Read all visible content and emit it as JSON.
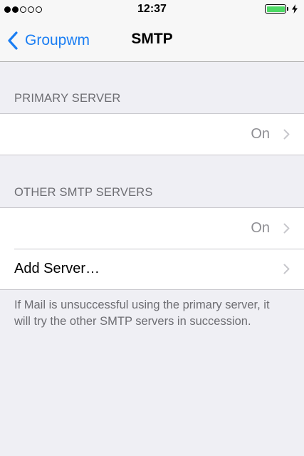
{
  "status_bar": {
    "time": "12:37",
    "signal_filled": 2,
    "signal_total": 5,
    "battery_level": 1.0,
    "battery_color": "#4cd964",
    "charging_icon": "bolt-icon"
  },
  "nav": {
    "back_label": "Groupwm",
    "back_icon": "chevron-left-icon",
    "title": "SMTP",
    "accent_color": "#1a7ef3"
  },
  "primary_section": {
    "header": "PRIMARY SERVER",
    "rows": [
      {
        "label": "",
        "value": "On",
        "icon": "chevron-right-icon"
      }
    ]
  },
  "other_section": {
    "header": "OTHER SMTP SERVERS",
    "rows": [
      {
        "label": "",
        "value": "On",
        "icon": "chevron-right-icon"
      },
      {
        "label": "Add Server…",
        "value": "",
        "icon": "chevron-right-icon"
      }
    ],
    "footer": "If Mail is unsuccessful using the primary server, it will try the other SMTP servers in succession."
  }
}
